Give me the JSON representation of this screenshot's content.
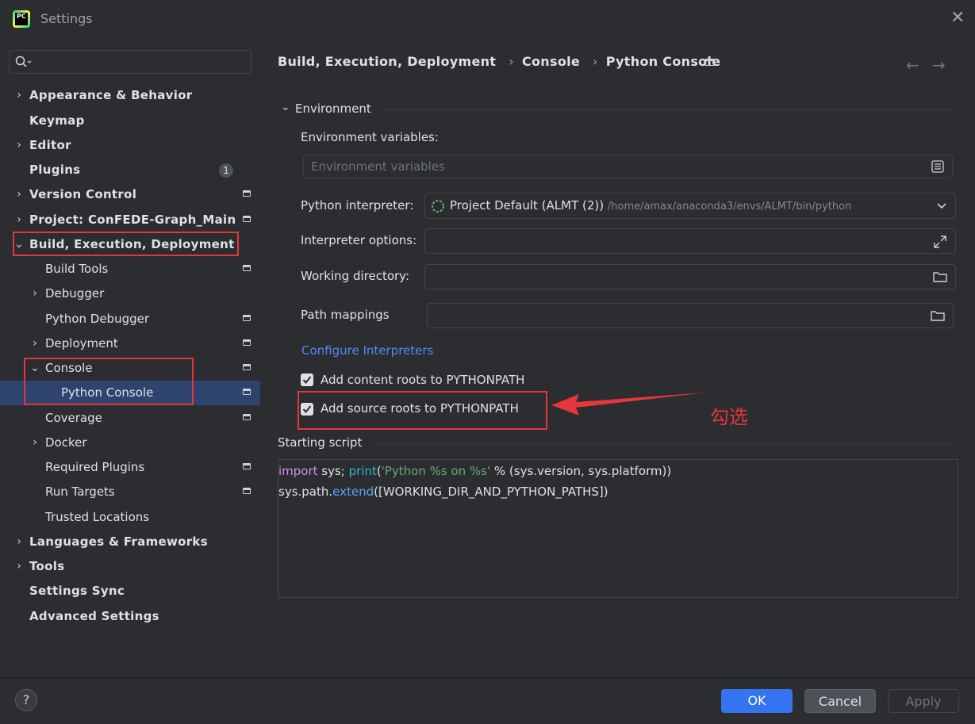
{
  "window": {
    "title": "Settings"
  },
  "search": {
    "placeholder": ""
  },
  "sidebar": {
    "items": [
      {
        "label": "Appearance & Behavior"
      },
      {
        "label": "Keymap"
      },
      {
        "label": "Editor"
      },
      {
        "label": "Plugins",
        "badge": "1"
      },
      {
        "label": "Version Control"
      },
      {
        "label": "Project: ConFEDE-Graph_Main"
      },
      {
        "label": "Build, Execution, Deployment"
      },
      {
        "label": "Build Tools"
      },
      {
        "label": "Debugger"
      },
      {
        "label": "Python Debugger"
      },
      {
        "label": "Deployment"
      },
      {
        "label": "Console"
      },
      {
        "label": "Python Console"
      },
      {
        "label": "Coverage"
      },
      {
        "label": "Docker"
      },
      {
        "label": "Required Plugins"
      },
      {
        "label": "Run Targets"
      },
      {
        "label": "Trusted Locations"
      },
      {
        "label": "Languages & Frameworks"
      },
      {
        "label": "Tools"
      },
      {
        "label": "Settings Sync"
      },
      {
        "label": "Advanced Settings"
      }
    ]
  },
  "breadcrumb": [
    "Build, Execution, Deployment",
    "Console",
    "Python Console"
  ],
  "breadcrumb_separator": "›",
  "nav": {
    "back": "←",
    "forward": "→"
  },
  "environment": {
    "section_title": "Environment",
    "env_vars_label": "Environment variables:",
    "env_vars_placeholder": "Environment variables",
    "interpreter_label": "Python interpreter:",
    "interpreter_name": "Project Default (ALMT (2))",
    "interpreter_path": "/home/amax/anaconda3/envs/ALMT/bin/python",
    "interpreter_options_label": "Interpreter options:",
    "working_directory_label": "Working directory:",
    "path_mappings_label": "Path mappings",
    "configure_link": "Configure Interpreters",
    "add_content_roots": {
      "label": "Add content roots to PYTHONPATH",
      "checked": true
    },
    "add_source_roots": {
      "label": "Add source roots to PYTHONPATH",
      "checked": true
    }
  },
  "starting_script": {
    "title": "Starting script",
    "line1": {
      "kw": "import",
      "t1": " sys; ",
      "builtin": "print",
      "t2": "(",
      "str": "'Python %s on %s'",
      "t3": " % (sys.version, sys.platform))"
    },
    "line2": {
      "t1": "sys.path.",
      "fn": "extend",
      "t2": "([WORKING_DIR_AND_PYTHON_PATHS])"
    }
  },
  "annotation": "勾选",
  "footer": {
    "help": "?",
    "ok": "OK",
    "cancel": "Cancel",
    "apply": "Apply"
  },
  "colors": {
    "accent": "#3574f0",
    "selection": "#2e436e",
    "annotation_red": "#e5363a",
    "link": "#548af7"
  }
}
